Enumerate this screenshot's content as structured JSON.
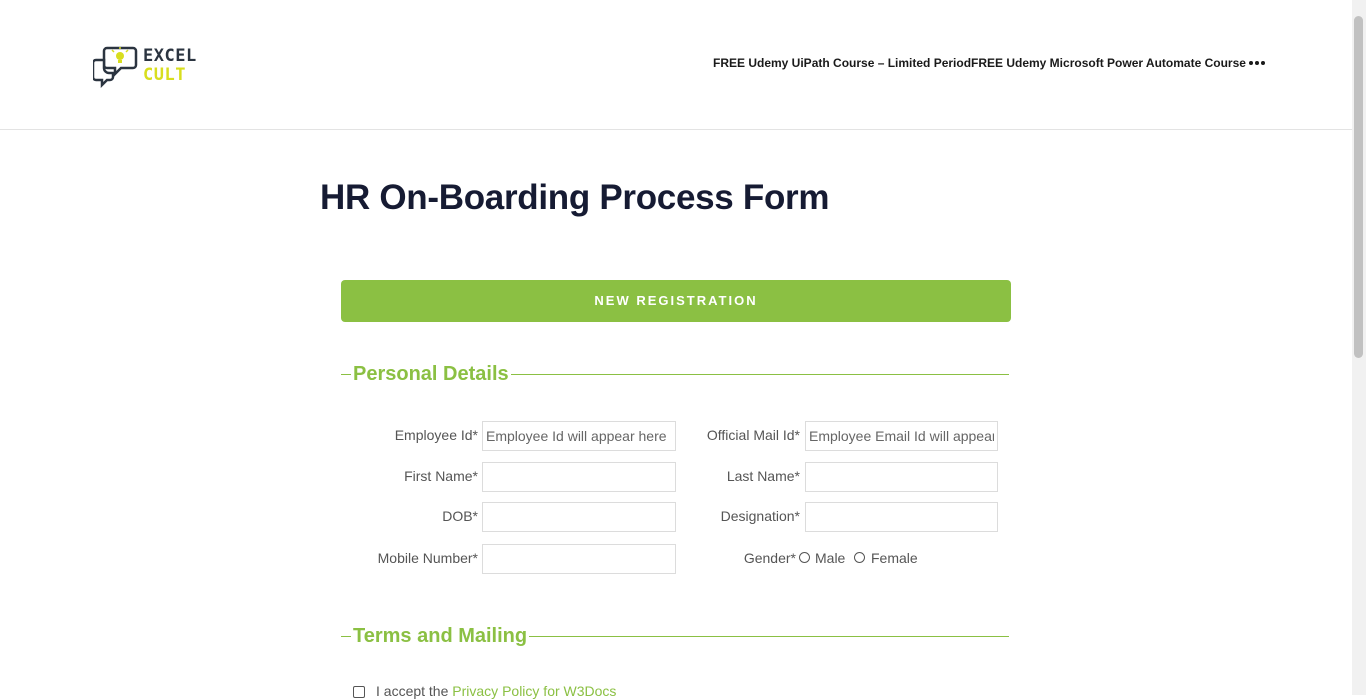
{
  "header": {
    "logo": {
      "line1": "EXCEL",
      "line2": "CULT"
    },
    "nav": [
      {
        "label": "FREE Udemy UiPath Course – Limited Period"
      },
      {
        "label": "FREE Udemy Microsoft Power Automate Course"
      }
    ],
    "more_icon": "ellipsis-icon"
  },
  "page": {
    "title": "HR On-Boarding Process Form"
  },
  "form": {
    "register_button": "NEW REGISTRATION",
    "personal_section": "Personal Details",
    "fields": {
      "employee_id": {
        "label": "Employee Id*",
        "placeholder": "Employee Id will appear here",
        "value": ""
      },
      "official_mail": {
        "label": "Official Mail Id*",
        "placeholder": "Employee Email Id will appear here",
        "value": ""
      },
      "first_name": {
        "label": "First Name*",
        "value": ""
      },
      "last_name": {
        "label": "Last Name*",
        "value": ""
      },
      "dob": {
        "label": "DOB*",
        "value": ""
      },
      "designation": {
        "label": "Designation*",
        "value": ""
      },
      "mobile": {
        "label": "Mobile Number*",
        "value": ""
      },
      "gender": {
        "label": "Gender*",
        "options": [
          "Male",
          "Female"
        ],
        "selected": null
      }
    },
    "terms_section": "Terms and Mailing",
    "terms": {
      "text": "I accept the ",
      "link": "Privacy Policy for W3Docs",
      "checked": false
    }
  },
  "colors": {
    "accent": "#8bc043",
    "title": "#161b33",
    "logo_dark": "#2b3440",
    "logo_yellow": "#d8de1e"
  }
}
